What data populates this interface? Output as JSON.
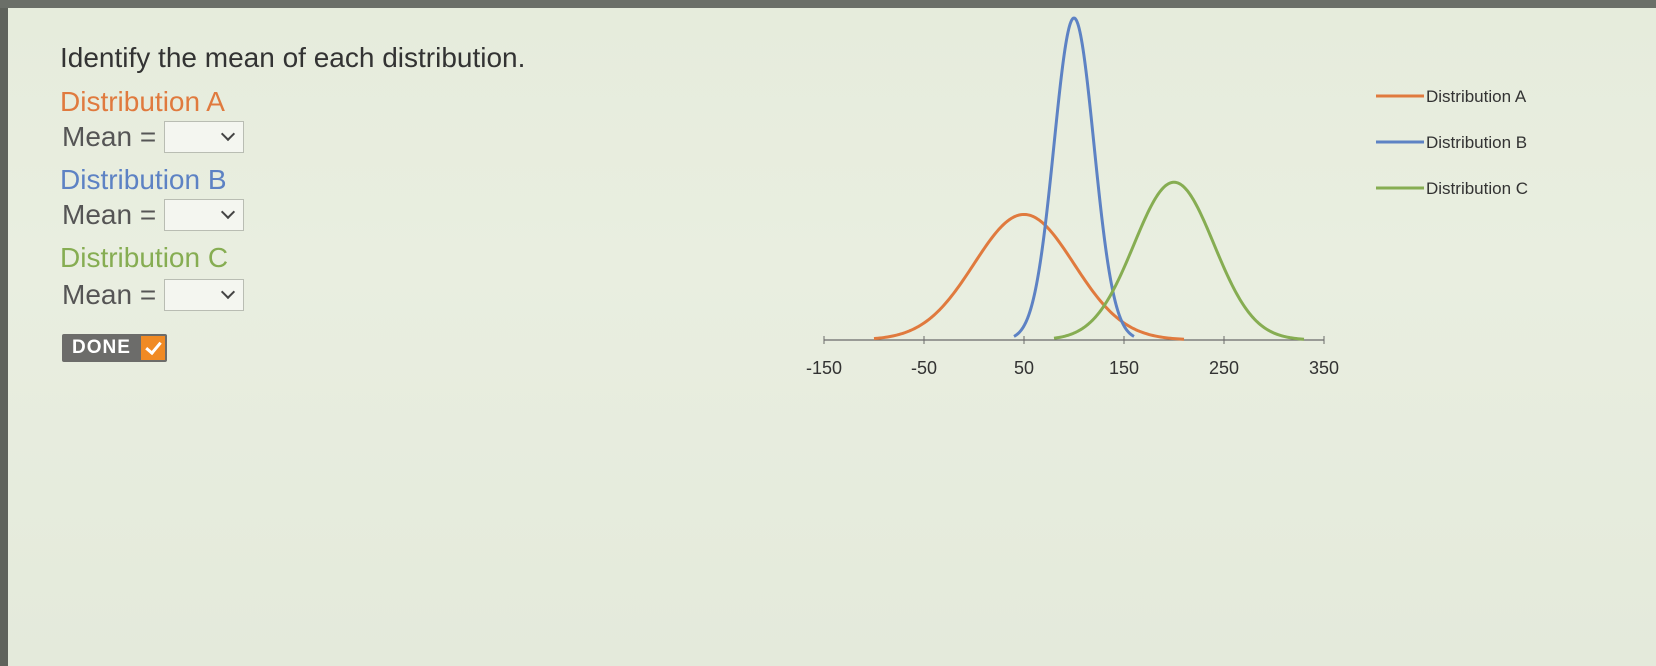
{
  "question": "Identify the mean of each distribution.",
  "distributions": [
    {
      "title": "Distribution A",
      "mean_label": "Mean =",
      "selected": ""
    },
    {
      "title": "Distribution B",
      "mean_label": "Mean =",
      "selected": ""
    },
    {
      "title": "Distribution C",
      "mean_label": "Mean =",
      "selected": ""
    }
  ],
  "done_label": "DONE",
  "colors": {
    "a": "#e07a3e",
    "b": "#5d82c4",
    "c": "#86ad52"
  },
  "chart_data": {
    "type": "line",
    "title": "",
    "xlabel": "",
    "ylabel": "",
    "xlim": [
      -150,
      350
    ],
    "x_ticks": [
      "-150",
      "-50",
      "50",
      "150",
      "250",
      "350"
    ],
    "legend_position": "right",
    "series": [
      {
        "name": "Distribution A",
        "color": "#e07a3e",
        "mean": 50,
        "sd": 50,
        "x_range": [
          -100,
          210
        ],
        "peak_relative": 0.39
      },
      {
        "name": "Distribution B",
        "color": "#5d82c4",
        "mean": 100,
        "sd": 20,
        "x_range": [
          40,
          160
        ],
        "peak_relative": 1.0
      },
      {
        "name": "Distribution C",
        "color": "#86ad52",
        "mean": 200,
        "sd": 40,
        "x_range": [
          80,
          330
        ],
        "peak_relative": 0.49
      }
    ]
  }
}
